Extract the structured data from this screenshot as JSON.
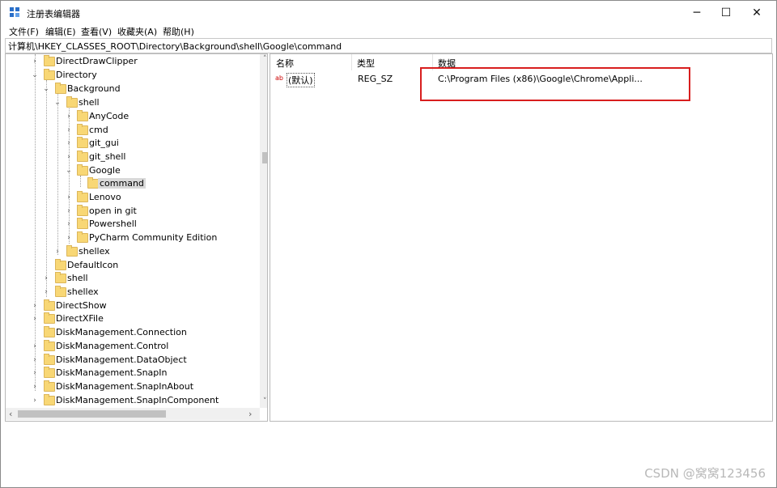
{
  "window": {
    "title": "注册表编辑器",
    "controls": {
      "minimize": "─",
      "maximize": "☐",
      "close": "✕"
    }
  },
  "menu": [
    "文件(F)",
    "编辑(E)",
    "查看(V)",
    "收藏夹(A)",
    "帮助(H)"
  ],
  "address": "计算机\\HKEY_CLASSES_ROOT\\Directory\\Background\\shell\\Google\\command",
  "tree": [
    {
      "label": "DirectDrawClipper",
      "expander": "›"
    },
    {
      "label": "Directory",
      "expander": "⌄"
    },
    {
      "label": "Background",
      "expander": "⌄"
    },
    {
      "label": "shell",
      "expander": "⌄"
    },
    {
      "label": "AnyCode",
      "expander": "›"
    },
    {
      "label": "cmd",
      "expander": "›"
    },
    {
      "label": "git_gui",
      "expander": "›"
    },
    {
      "label": "git_shell",
      "expander": "›"
    },
    {
      "label": "Google",
      "expander": "⌄"
    },
    {
      "label": "command",
      "expander": ""
    },
    {
      "label": "Lenovo",
      "expander": "›"
    },
    {
      "label": "open in git",
      "expander": "›"
    },
    {
      "label": "Powershell",
      "expander": "›"
    },
    {
      "label": "PyCharm Community Edition",
      "expander": "›"
    },
    {
      "label": "shellex",
      "expander": "›"
    },
    {
      "label": "DefaultIcon",
      "expander": ""
    },
    {
      "label": "shell",
      "expander": "›"
    },
    {
      "label": "shellex",
      "expander": "›"
    },
    {
      "label": "DirectShow",
      "expander": "›"
    },
    {
      "label": "DirectXFile",
      "expander": "›"
    },
    {
      "label": "DiskManagement.Connection",
      "expander": ""
    },
    {
      "label": "DiskManagement.Control",
      "expander": "›"
    },
    {
      "label": "DiskManagement.DataObject",
      "expander": "›"
    },
    {
      "label": "DiskManagement.SnapIn",
      "expander": "›"
    },
    {
      "label": "DiskManagement.SnapInAbout",
      "expander": "›"
    },
    {
      "label": "DiskManagement.SnapInComponent",
      "expander": "›"
    }
  ],
  "scroll": {
    "up": "˄",
    "down": "˅",
    "left": "‹",
    "right": "›"
  },
  "list": {
    "headers": {
      "name": "名称",
      "type": "类型",
      "data": "数据"
    },
    "rows": [
      {
        "icon": "ab",
        "name": "(默认)",
        "type": "REG_SZ",
        "data": "C:\\Program Files (x86)\\Google\\Chrome\\Appli..."
      }
    ]
  },
  "watermark": "CSDN @窝窝123456",
  "colors": {
    "highlight_box": "#d81e1e",
    "folder": "#f8d775"
  }
}
